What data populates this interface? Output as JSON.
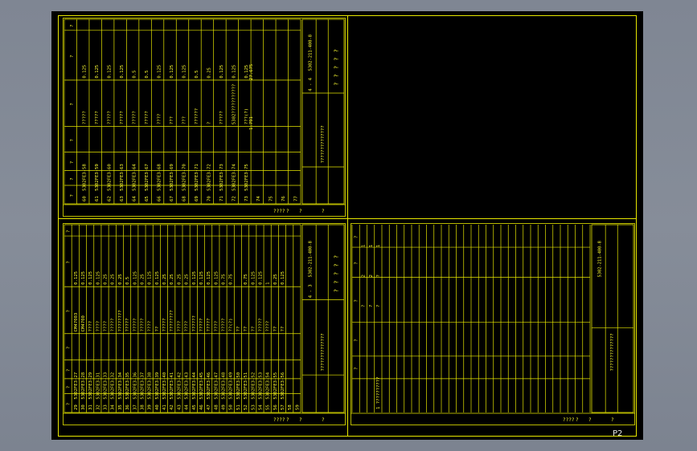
{
  "viewer": {
    "page_label": "P2"
  },
  "colors": {
    "line": "#e6e600",
    "text": "#ffff33",
    "background": "#000000"
  },
  "blocks": [
    {
      "id": "top-left",
      "drawing_number": "5302-211-400-8",
      "sheet_index": "4 - 4",
      "header": [
        "?",
        "?",
        "?",
        "?",
        "?",
        "?",
        "?",
        "?",
        "?"
      ],
      "rows": [
        [
          "60",
          "5302FE3-58",
          "?????",
          "",
          "0.125",
          ""
        ],
        [
          "61",
          "5302FE3-59",
          "?????",
          "",
          "0.125",
          ""
        ],
        [
          "62",
          "5302FE3-60",
          "?????",
          "",
          "0.125",
          ""
        ],
        [
          "63",
          "5302FE3-63",
          "?????",
          "",
          "0.125",
          ""
        ],
        [
          "64",
          "5302FE3-64",
          "?????",
          "",
          "0.5",
          ""
        ],
        [
          "65",
          "5302FE3-67",
          "?????",
          "",
          "0.5",
          ""
        ],
        [
          "66",
          "5302FE3-68",
          "????",
          "",
          "0.125",
          ""
        ],
        [
          "67",
          "5302FE3-69",
          "???",
          "",
          "0.125",
          ""
        ],
        [
          "68",
          "5302FE3-70",
          "???",
          "",
          "0.125",
          ""
        ],
        [
          "69",
          "5302FE3-71",
          "??????",
          "",
          "0.5",
          ""
        ],
        [
          "70",
          "5302FE3-72",
          "?",
          "",
          "0.25",
          ""
        ],
        [
          "71",
          "5302FE3-73",
          "?????",
          "",
          "0.125",
          ""
        ],
        [
          "72",
          "5302FE3-74",
          "5302???????????",
          "",
          "0.125",
          ""
        ],
        [
          "73",
          "5302FE3-75",
          "???(?)",
          "",
          "0.125",
          ""
        ],
        [
          "74",
          "",
          "",
          "",
          "",
          ""
        ],
        [
          "75",
          "",
          "",
          "",
          "",
          ""
        ],
        [
          "76",
          "",
          "",
          "",
          "",
          ""
        ],
        [
          "77",
          "",
          "",
          "",
          "",
          ""
        ]
      ],
      "total_left": "1.791",
      "total_right": "27.675",
      "title_text": "??????????????",
      "sign_rows": [
        "?",
        "?",
        "?",
        "?",
        "?"
      ],
      "footer": [
        "????",
        "?",
        "?",
        "?"
      ]
    },
    {
      "id": "bottom-left",
      "drawing_number": "5302-211-400-8",
      "sheet_index": "4 - 3",
      "header": [
        "?",
        "?",
        "?",
        "?",
        "?",
        "?",
        "?",
        "?",
        "?"
      ],
      "rows": [
        [
          "29",
          "5302FE3-27",
          "CM47003",
          "",
          "0.125",
          ""
        ],
        [
          "30",
          "5302FE3-28",
          "CM4700",
          "",
          "0.125",
          ""
        ],
        [
          "31",
          "5302FE3-29",
          "????",
          "",
          "0.125",
          ""
        ],
        [
          "32",
          "5302FE3-31",
          "????",
          "",
          "0.125",
          ""
        ],
        [
          "33",
          "5302FE3-33",
          "????",
          "",
          "0.25",
          ""
        ],
        [
          "34",
          "5302FE3-32",
          "?????",
          "",
          "0.25",
          ""
        ],
        [
          "35",
          "5302FE3-34",
          "????????",
          "",
          "0.25",
          ""
        ],
        [
          "36",
          "5302FE3-35",
          "?????",
          "",
          "0.5",
          ""
        ],
        [
          "37",
          "5302FE3-36",
          "?????",
          "",
          "0.125",
          ""
        ],
        [
          "38",
          "5302FE3-37",
          "?????",
          "",
          "0.25",
          ""
        ],
        [
          "39",
          "5302FE3-38",
          "????",
          "",
          "0.125",
          ""
        ],
        [
          "40",
          "5302FE3-39",
          "??",
          "",
          "0.125",
          ""
        ],
        [
          "41",
          "5302FE3-40",
          "?????",
          "",
          "0.25",
          ""
        ],
        [
          "42",
          "5302FE3-41",
          "????????",
          "",
          "0.25",
          ""
        ],
        [
          "43",
          "5302FE3-42",
          "????",
          "",
          "0.25",
          ""
        ],
        [
          "44",
          "5302FE3-43",
          "????",
          "",
          "0.25",
          ""
        ],
        [
          "45",
          "5302FE3-44",
          "??????",
          "",
          "0.125",
          ""
        ],
        [
          "46",
          "5302FE3-45",
          "?????",
          "",
          "0.125",
          ""
        ],
        [
          "47",
          "5302FE3-46",
          "?????",
          "",
          "0.125",
          ""
        ],
        [
          "48",
          "5302FE3-47",
          "????",
          "",
          "0.125",
          ""
        ],
        [
          "49",
          "5302FE3-48",
          "?????",
          "",
          "0.75",
          ""
        ],
        [
          "50",
          "5302FE3-49",
          "??(?)",
          "",
          "0.75",
          ""
        ],
        [
          "51",
          "5302FE3-50",
          "??",
          "",
          "",
          ""
        ],
        [
          "52",
          "5302FE3-51",
          "??",
          "",
          "0.75",
          ""
        ],
        [
          "53",
          "5302FE3-52",
          "??",
          "",
          "0.125",
          ""
        ],
        [
          "54",
          "5302FE3-53",
          "?????",
          "",
          "0.125",
          ""
        ],
        [
          "55",
          "5302FE3-54",
          "????",
          "",
          "1",
          ""
        ],
        [
          "56",
          "5302FE3-55",
          "??",
          "",
          "0.25",
          ""
        ],
        [
          "57",
          "5302FE3-56",
          "??",
          "",
          "0.125",
          ""
        ],
        [
          "58",
          "",
          "",
          "",
          "",
          ""
        ],
        [
          "59",
          "",
          "",
          "",
          "",
          ""
        ]
      ],
      "title_text": "??????????????",
      "sign_rows": [
        "?",
        "?",
        "?",
        "?",
        "?"
      ],
      "footer": [
        "????",
        "?",
        "?",
        "?"
      ]
    },
    {
      "id": "bottom-right",
      "drawing_number": "5302-211-400-8",
      "header": [
        "?",
        "?",
        "?",
        "?",
        "?"
      ],
      "item_texts": [
        "1",
        "1",
        "1",
        "2",
        "2",
        "?",
        "?",
        "?",
        "?"
      ],
      "row_note": "1 ??????????",
      "title_text": "??????????????",
      "footer": [
        "????",
        "?",
        "?",
        "?"
      ]
    }
  ]
}
